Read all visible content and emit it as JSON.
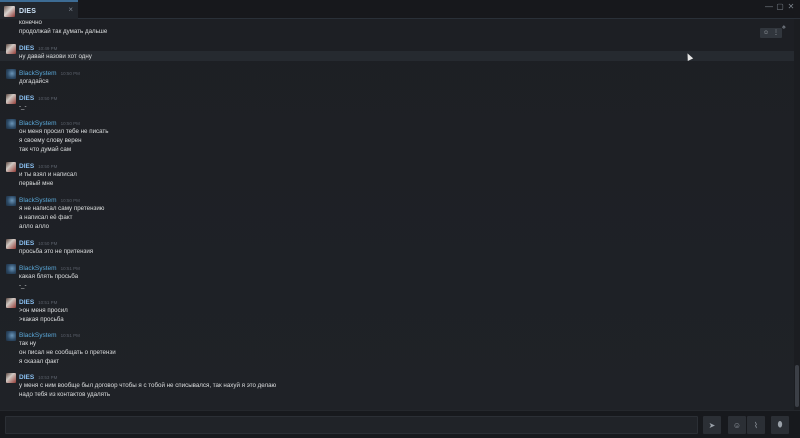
{
  "tab": {
    "title": "DIES",
    "close": "×"
  },
  "window": {
    "minimize": "—",
    "maximize": "▢",
    "close": "✕"
  },
  "hover_tools": {
    "emoji": "☺",
    "more": "⋮"
  },
  "messages": {
    "m0": {
      "lines": [
        "конечно",
        "продолжай так думать дальше"
      ]
    },
    "m1": {
      "author": "DIES",
      "time": "10:49 PM",
      "lines": [
        "ну давай назови хот одну"
      ]
    },
    "m2": {
      "author": "BlackSystem",
      "time": "10:50 PM",
      "lines": [
        "догадайся"
      ]
    },
    "m3": {
      "author": "DIES",
      "time": "10:50 PM",
      "lines": [
        "-_-"
      ]
    },
    "m4": {
      "author": "BlackSystem",
      "time": "10:50 PM",
      "lines": [
        "он меня просил тебе не писать",
        "я своему слову верен",
        "так что думай сам"
      ]
    },
    "m5": {
      "author": "DIES",
      "time": "10:50 PM",
      "lines": [
        "и ты взял и написал",
        "первый мне"
      ]
    },
    "m6": {
      "author": "BlackSystem",
      "time": "10:50 PM",
      "lines": [
        "я не написал саму претензию",
        "а написал её факт",
        "алло алло"
      ]
    },
    "m7": {
      "author": "DIES",
      "time": "10:50 PM",
      "lines": [
        "просьба это не притензия"
      ]
    },
    "m8": {
      "author": "BlackSystem",
      "time": "10:51 PM",
      "lines": [
        "какая блять просьба",
        "-_-"
      ]
    },
    "m9": {
      "author": "DIES",
      "time": "10:51 PM",
      "lines": [
        ">он меня просил",
        ">какая просьба"
      ]
    },
    "m10": {
      "author": "BlackSystem",
      "time": "10:51 PM",
      "lines": [
        "так ну",
        "он писал не сообщать о претензи",
        "я сказал факт"
      ]
    },
    "m11": {
      "author": "DIES",
      "time": "10:53 PM",
      "lines": [
        "у меня с ним вообще был договор чтобы я с тобой не списывался, так нахуй я это делаю",
        "надо тебя из контактов удалять"
      ]
    }
  },
  "composer": {
    "placeholder": "",
    "send_icon": "➤",
    "emoji_icon": "☺",
    "attach_icon": "⌇",
    "voice_icon": "⬮"
  },
  "colors": {
    "accent": "#3d6c94",
    "dies_name": "#8ac0f1",
    "bs_name": "#5aa8d8",
    "background": "#1f2126"
  }
}
